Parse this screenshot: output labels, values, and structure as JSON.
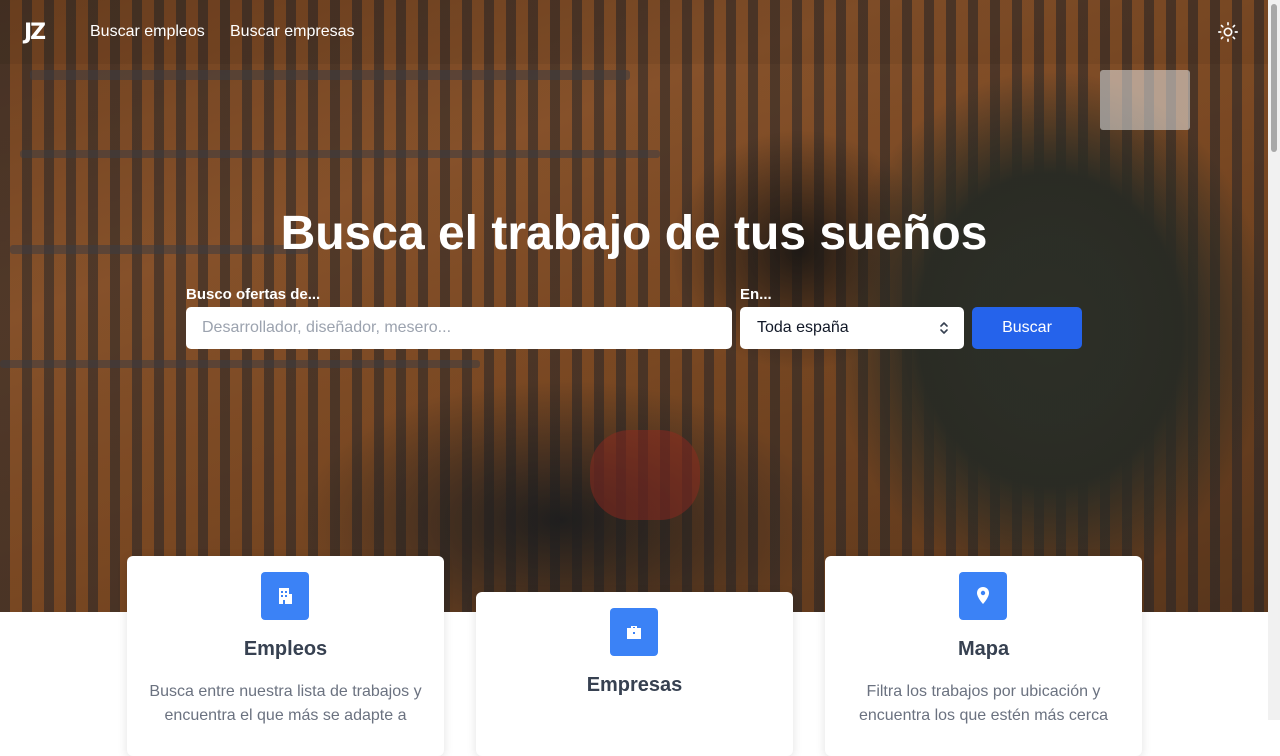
{
  "navbar": {
    "logo": "JZ",
    "links": [
      "Buscar empleos",
      "Buscar empresas"
    ],
    "theme_icon": "sun-icon"
  },
  "hero": {
    "title": "Busca el trabajo de tus sueños",
    "search": {
      "query_label": "Busco ofertas de...",
      "query_placeholder": "Desarrollador, diseñador, mesero...",
      "query_value": "",
      "location_label": "En...",
      "location_value": "Toda españa",
      "button_label": "Buscar"
    }
  },
  "cards": [
    {
      "icon": "building-icon",
      "title": "Empleos",
      "description": "Busca entre nuestra lista de trabajos y encuentra el que más se adapte a"
    },
    {
      "icon": "briefcase-icon",
      "title": "Empresas",
      "description": ""
    },
    {
      "icon": "map-pin-icon",
      "title": "Mapa",
      "description": "Filtra los trabajos por ubicación y encuentra los que estén más cerca"
    }
  ],
  "colors": {
    "accent": "#2563eb",
    "icon_bg": "#3b82f6"
  }
}
